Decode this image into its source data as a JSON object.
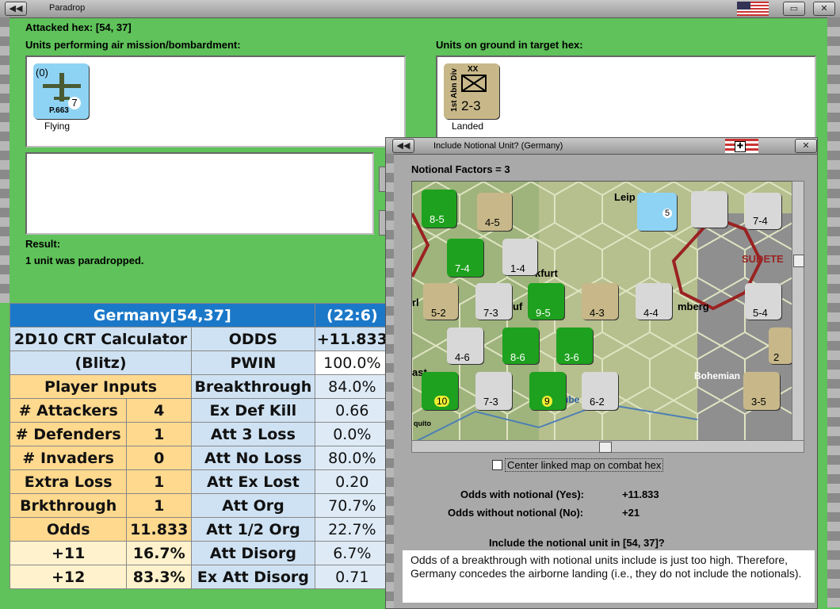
{
  "main_window": {
    "title": "Paradrop",
    "attacked_hex": "Attacked hex:  [54, 37]",
    "air_units_label": "Units performing air mission/bombardment:",
    "ground_units_label": "Units on ground in target hex:",
    "air_unit": {
      "strength": "(0)",
      "id": "P.663",
      "value": "7",
      "status": "Flying"
    },
    "ground_unit": {
      "name": "1st Abn Div",
      "size": "XX",
      "factors": "2-3",
      "status": "Landed"
    },
    "result_label": "Result:",
    "result_text": "1 unit was paradropped."
  },
  "crt": {
    "title": "Germany[54,37]",
    "timestamp": "(22:6)",
    "calc_line1": "2D10 CRT Calculator",
    "calc_line2": "(Blitz)",
    "player_inputs": "Player Inputs",
    "inputs": [
      {
        "label": "# Attackers",
        "value": "4"
      },
      {
        "label": "# Defenders",
        "value": "1"
      },
      {
        "label": "# Invaders",
        "value": "0"
      },
      {
        "label": "Extra Loss",
        "value": "1"
      },
      {
        "label": "Brkthrough",
        "value": "1"
      },
      {
        "label": "Odds",
        "value": "11.833"
      },
      {
        "label": "+11",
        "value": "16.7%"
      },
      {
        "label": "+12",
        "value": "83.3%"
      }
    ],
    "results": [
      {
        "label": "ODDS",
        "value": "+11.833"
      },
      {
        "label": "PWIN",
        "value": "100.0%"
      },
      {
        "label": "Breakthrough",
        "value": "84.0%"
      },
      {
        "label": "Ex Def Kill",
        "value": "0.66"
      },
      {
        "label": "Att 3 Loss",
        "value": "0.0%"
      },
      {
        "label": "Att No Loss",
        "value": "80.0%"
      },
      {
        "label": "Att Ex Lost",
        "value": "0.20"
      },
      {
        "label": "Att Org",
        "value": "70.7%"
      },
      {
        "label": "Att 1/2 Org",
        "value": "22.7%"
      },
      {
        "label": "Att Disorg",
        "value": "6.7%"
      },
      {
        "label": "Ex Att Disorg",
        "value": "0.71"
      }
    ]
  },
  "dialog": {
    "title": "Include Notional Unit? (Germany)",
    "notional_factors": "Notional Factors = 3",
    "center_checkbox": "Center linked map on combat hex",
    "odds_yes_label": "Odds with notional (Yes):",
    "odds_yes_value": "+11.833",
    "odds_no_label": "Odds without notional (No):",
    "odds_no_value": "+21",
    "question": "Include the notional unit in  [54, 37]?",
    "commentary": "Odds of a breakthrough with notional units include is just too high.  Therefore, Germany concedes the airborne landing (i.e., they do not include the notionals).",
    "map_labels": [
      "Leip",
      "kfurt",
      "mberg",
      "SUDETE",
      "Bohemian",
      "rl",
      "ruf",
      "ast",
      "ube",
      "quito"
    ],
    "map_counters": [
      {
        "factors": "8-5"
      },
      {
        "factors": "4-5"
      },
      {
        "factors": "5"
      },
      {
        "factors": "7-4"
      },
      {
        "factors": "7-4"
      },
      {
        "factors": "1-4"
      },
      {
        "factors": "5-2"
      },
      {
        "factors": "7-3"
      },
      {
        "factors": "9-5"
      },
      {
        "factors": "4-3"
      },
      {
        "factors": "4-4"
      },
      {
        "factors": "5-4"
      },
      {
        "factors": "4-6"
      },
      {
        "factors": "8-6"
      },
      {
        "factors": "3-6"
      },
      {
        "factors": "7-3"
      },
      {
        "factors": "9"
      },
      {
        "factors": "6-2"
      },
      {
        "factors": "3-5"
      },
      {
        "factors": "2"
      },
      {
        "factors": "10"
      }
    ]
  }
}
